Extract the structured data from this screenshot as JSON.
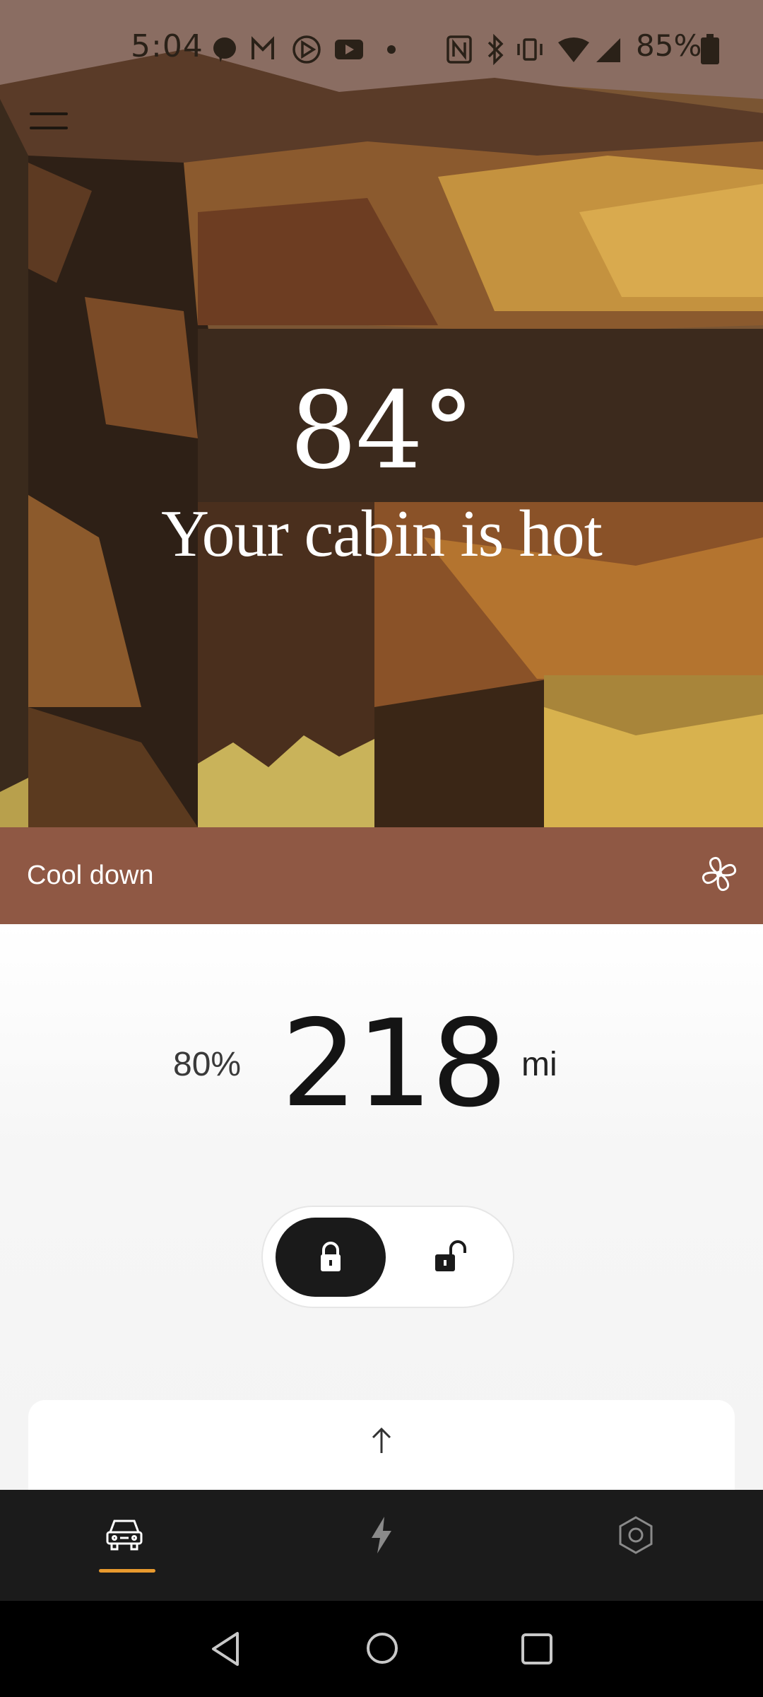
{
  "status_bar": {
    "time": "5:04",
    "battery_percent": "85%",
    "left_icons": [
      "messenger-icon",
      "gmail-icon",
      "media-icon",
      "youtube-icon",
      "dot-icon"
    ],
    "right_icons": [
      "nfc-icon",
      "bluetooth-icon",
      "vibrate-icon",
      "wifi-icon",
      "signal-icon",
      "battery-icon"
    ]
  },
  "hero": {
    "temperature": "84°",
    "message": "Your cabin is hot"
  },
  "banner": {
    "label": "Cool down",
    "icon": "fan-icon",
    "color": "#8f5844"
  },
  "range": {
    "battery_percent": "80%",
    "value": "218",
    "unit": "mi"
  },
  "lock_toggle": {
    "selected": "locked",
    "options": [
      "lock-icon",
      "unlock-icon"
    ]
  },
  "card": {
    "icon": "arrow-up-icon"
  },
  "bottom_nav": {
    "items": [
      {
        "icon": "car-icon",
        "active": true
      },
      {
        "icon": "charging-bolt-icon",
        "active": false
      },
      {
        "icon": "settings-hex-icon",
        "active": false
      }
    ],
    "accent": "#e89a2e"
  },
  "system_nav": {
    "items": [
      "back-icon",
      "home-icon",
      "recents-icon"
    ]
  }
}
